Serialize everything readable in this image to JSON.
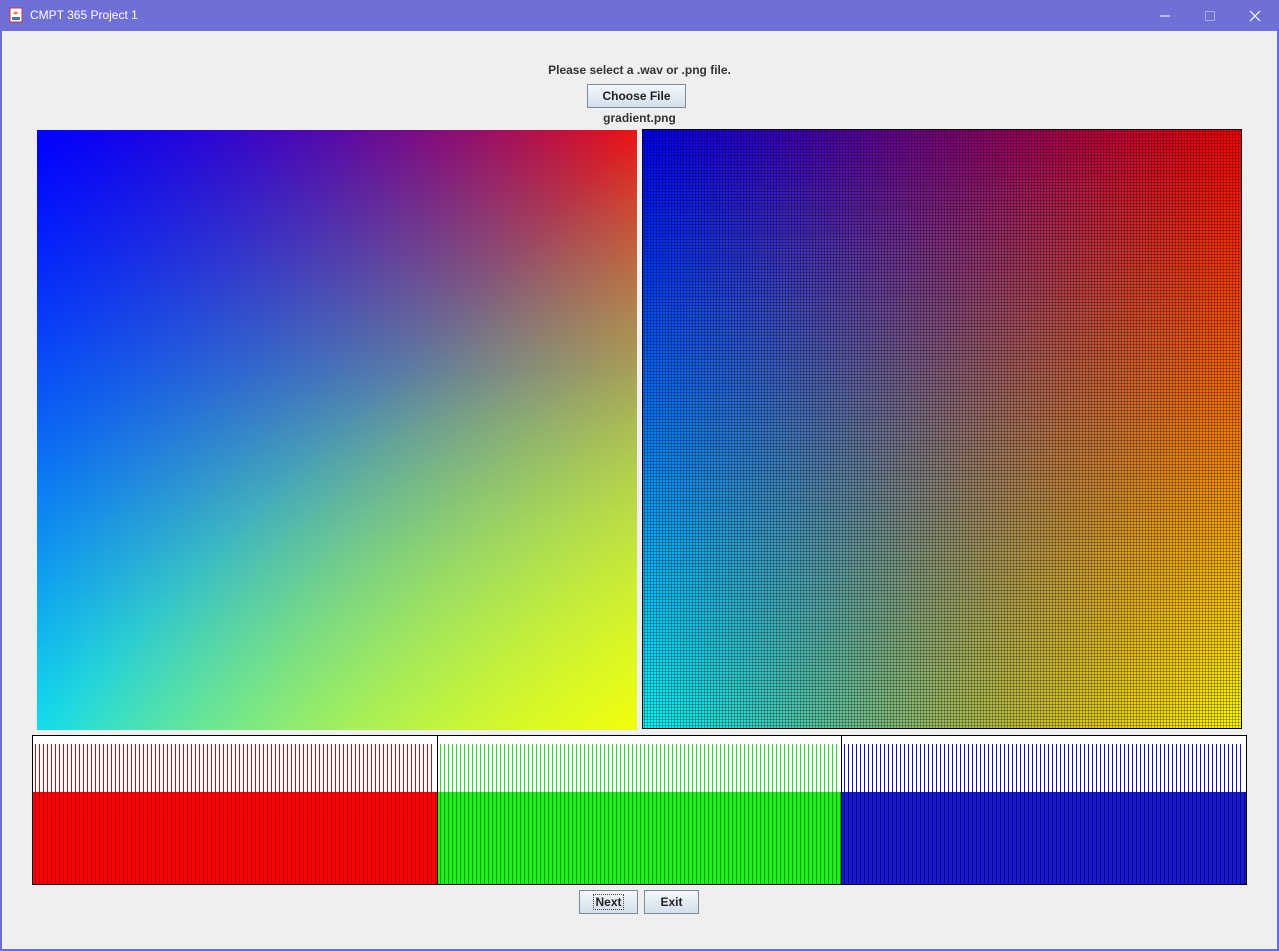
{
  "window": {
    "title": "CMPT 365 Project 1",
    "controls": [
      "minimize",
      "maximize",
      "close"
    ]
  },
  "main": {
    "prompt": "Please select a .wav or .png file.",
    "choose_file_label": "Choose File",
    "file_name": "gradient.png"
  },
  "images": {
    "original": {
      "description_icon": "image-preview"
    },
    "processed": {
      "description_icon": "dithered-image-preview"
    }
  },
  "histogram": {
    "channels": [
      {
        "channel": "red",
        "color": "#ff0000"
      },
      {
        "channel": "green",
        "color": "#22ee22"
      },
      {
        "channel": "blue",
        "color": "#1a1ad0"
      }
    ]
  },
  "footer": {
    "next_label": "Next",
    "exit_label": "Exit"
  },
  "colors": {
    "titlebar": "#6f6fd8",
    "background": "#efefef"
  }
}
